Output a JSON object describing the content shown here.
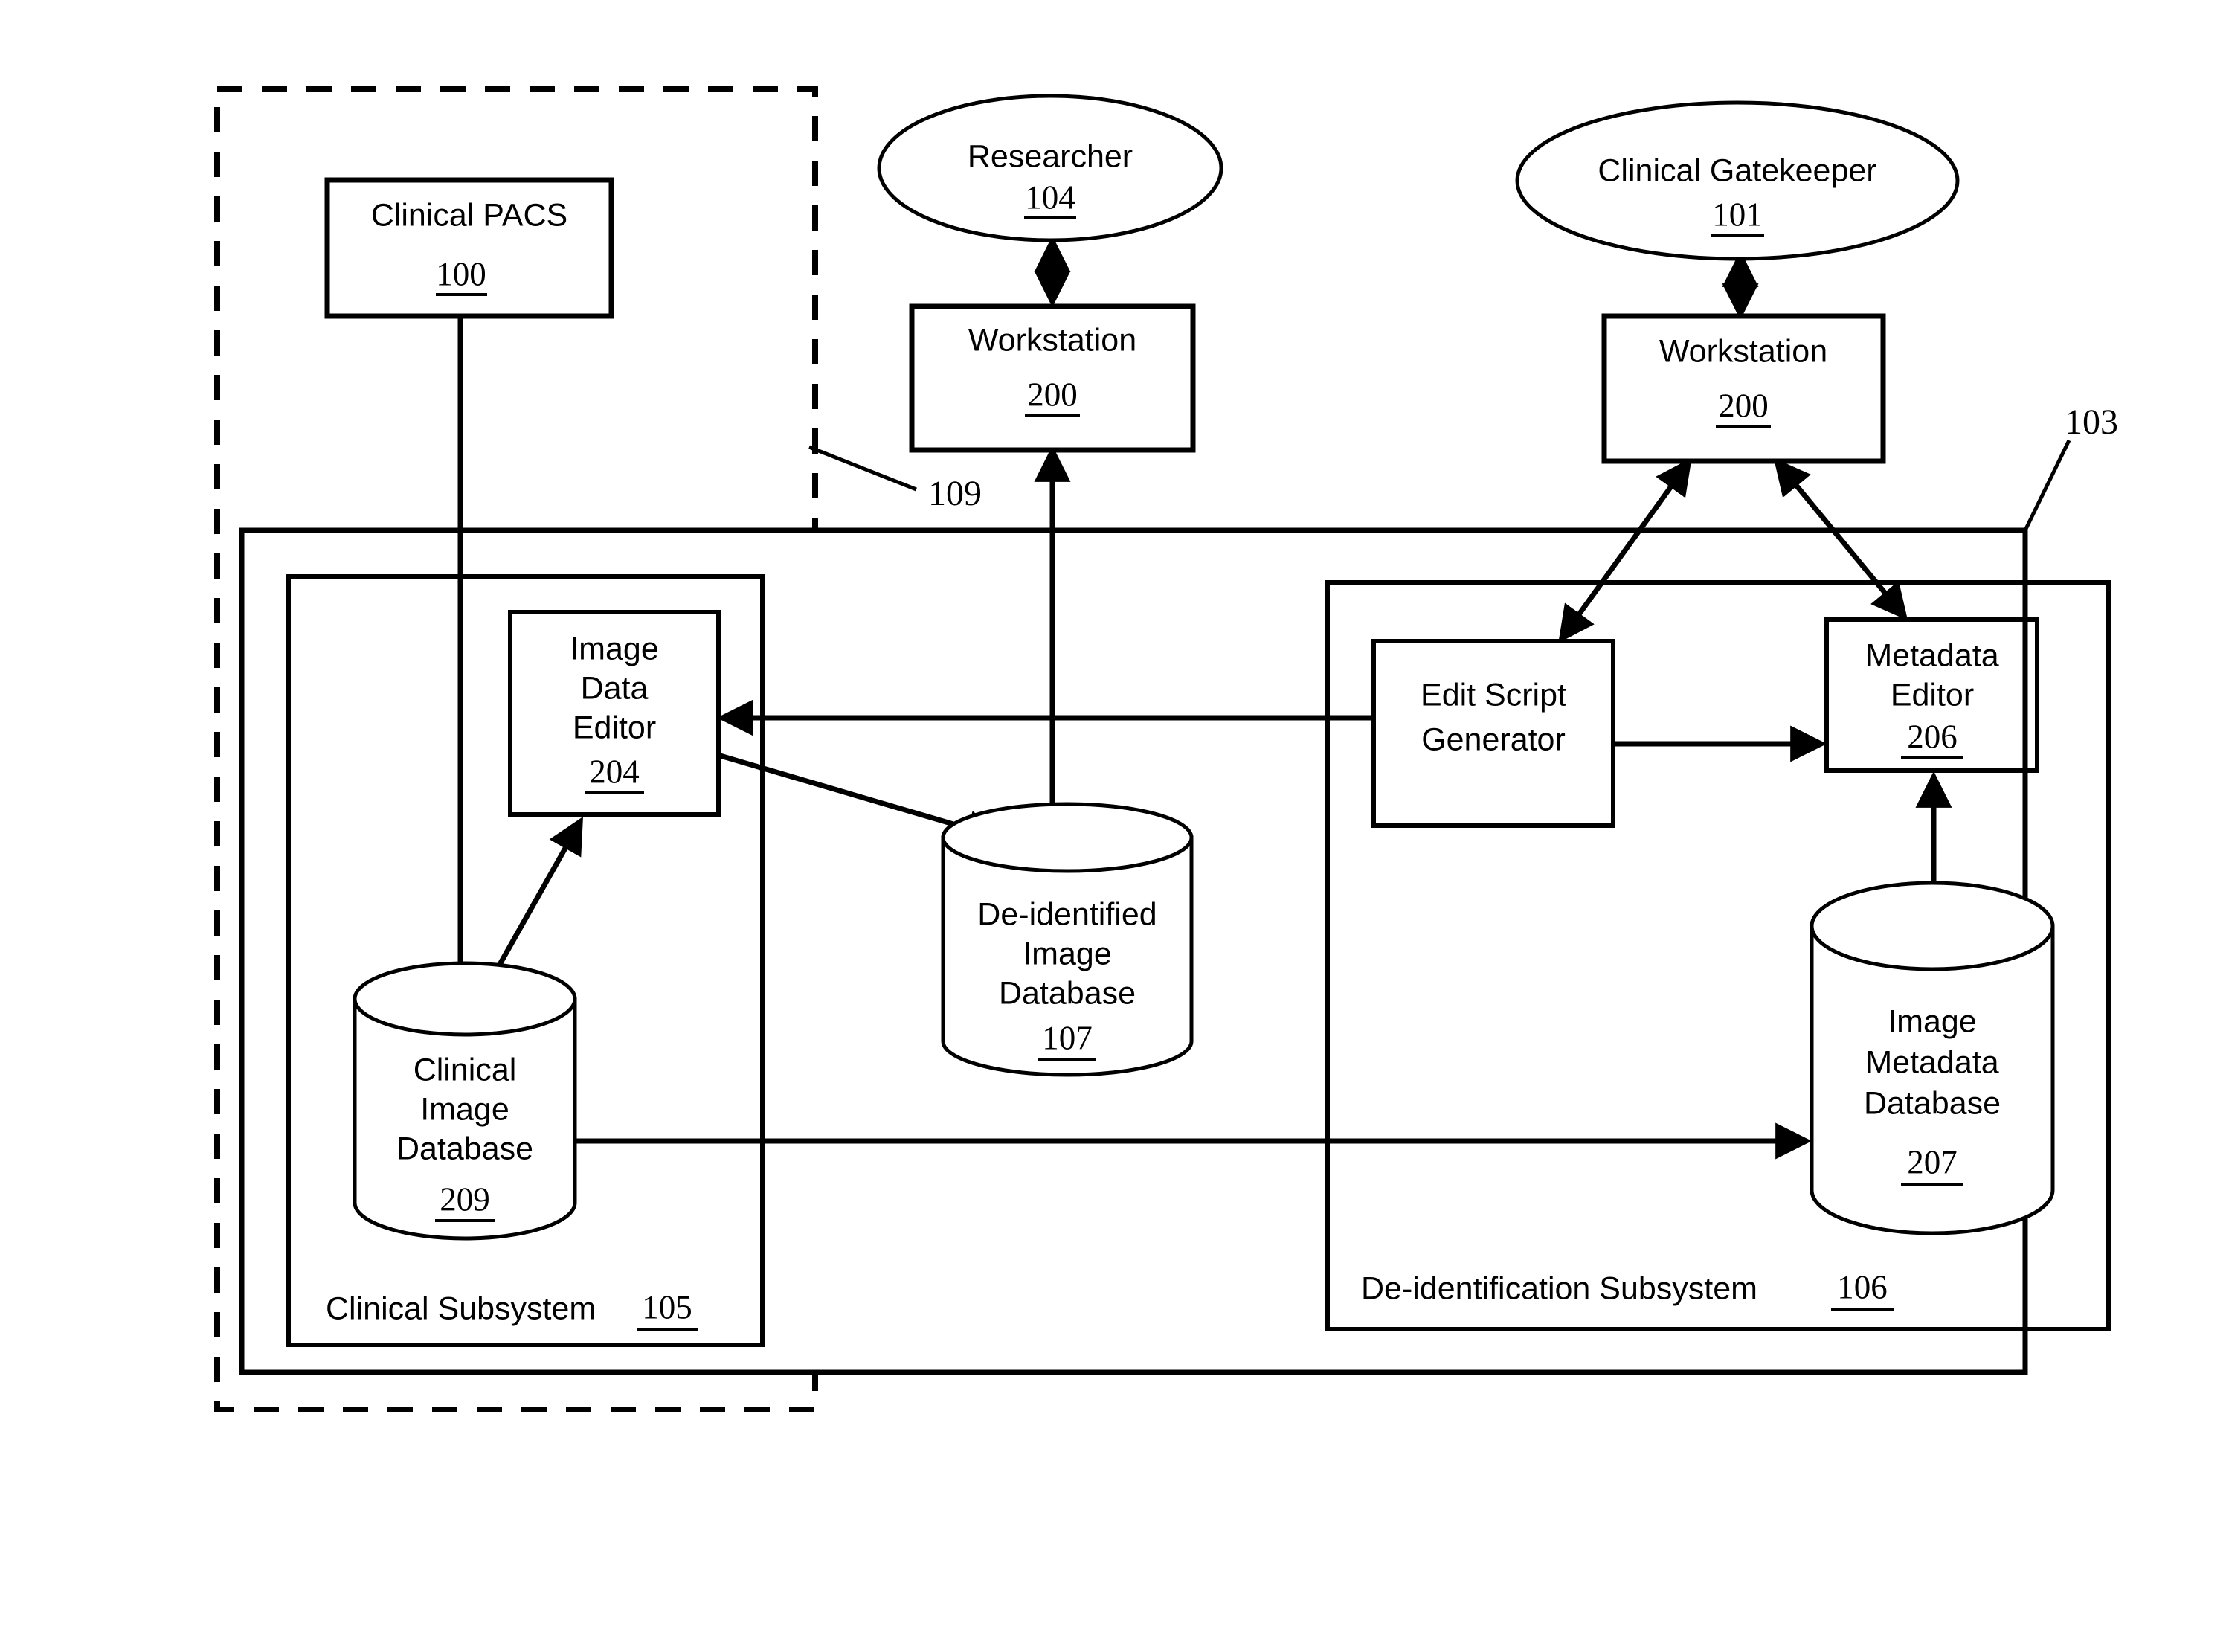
{
  "figure": {
    "type": "patent-block-diagram",
    "background": "#ffffff",
    "stroke_color": "#000000"
  },
  "actors": [
    {
      "id": "researcher",
      "label": "Researcher",
      "ref": "104"
    },
    {
      "id": "gatekeeper",
      "label": "Clinical Gatekeeper",
      "ref": "101"
    }
  ],
  "nodes": {
    "clinical_pacs": {
      "label": "Clinical PACS",
      "ref": "100"
    },
    "workstation_researcher": {
      "label": "Workstation",
      "ref": "200"
    },
    "workstation_gatekeeper": {
      "label": "Workstation",
      "ref": "200"
    },
    "image_data_editor": {
      "line1": "Image",
      "line2": "Data",
      "line3": "Editor",
      "ref": "204"
    },
    "edit_script_generator": {
      "line1": "Edit Script",
      "line2": "Generator",
      "ref": ""
    },
    "metadata_editor": {
      "line1": "Metadata",
      "line2": "Editor",
      "ref": "206"
    }
  },
  "databases": {
    "clinical_image_db": {
      "line1": "Clinical",
      "line2": "Image",
      "line3": "Database",
      "ref": "209"
    },
    "deidentified_image_db": {
      "line1": "De-identified",
      "line2": "Image",
      "line3": "Database",
      "ref": "107"
    },
    "image_metadata_db": {
      "line1": "Image",
      "line2": "Metadata",
      "line3": "Database",
      "ref": "207"
    }
  },
  "regions": {
    "clinical_subsystem": {
      "label": "Clinical Subsystem",
      "ref": "105"
    },
    "deidentification_subsystem": {
      "label": "De-identification Subsystem",
      "ref": "106"
    },
    "outer_system": {
      "ref": "103"
    },
    "trusted_boundary": {
      "ref": "109"
    }
  },
  "callouts": [
    {
      "id": "callout-109",
      "ref": "109"
    },
    {
      "id": "callout-103",
      "ref": "103"
    }
  ]
}
